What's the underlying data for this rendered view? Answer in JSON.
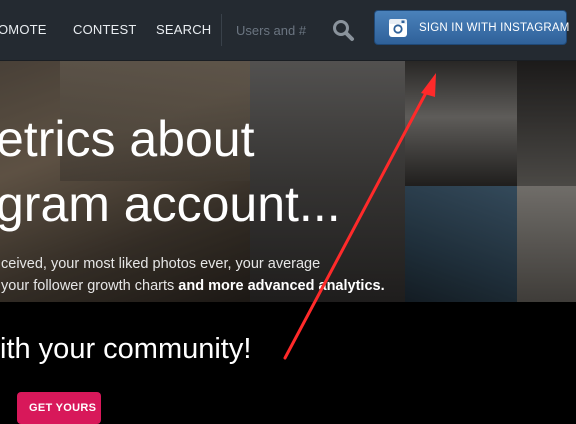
{
  "nav": {
    "items": [
      {
        "label": "OMOTE"
      },
      {
        "label": "CONTEST"
      },
      {
        "label": "SEARCH"
      }
    ],
    "search_placeholder": "Users and #",
    "search_icon": "search-icon",
    "signin": {
      "label": "SIGN IN WITH INSTAGRAM",
      "icon": "instagram-icon",
      "color": "#3b72ad"
    }
  },
  "hero": {
    "headline_line1": "etrics about",
    "headline_line2": "gram account...",
    "sub_line1": "ceived, your most liked photos ever, your average",
    "sub_line2_plain": "your follower growth charts ",
    "sub_line2_bold": "and more advanced analytics."
  },
  "community": {
    "text": "ith your community!"
  },
  "cta": {
    "label": "GET YOURS",
    "color": "#d8185a"
  },
  "annotation": {
    "arrow_color": "#ff2a2a"
  }
}
